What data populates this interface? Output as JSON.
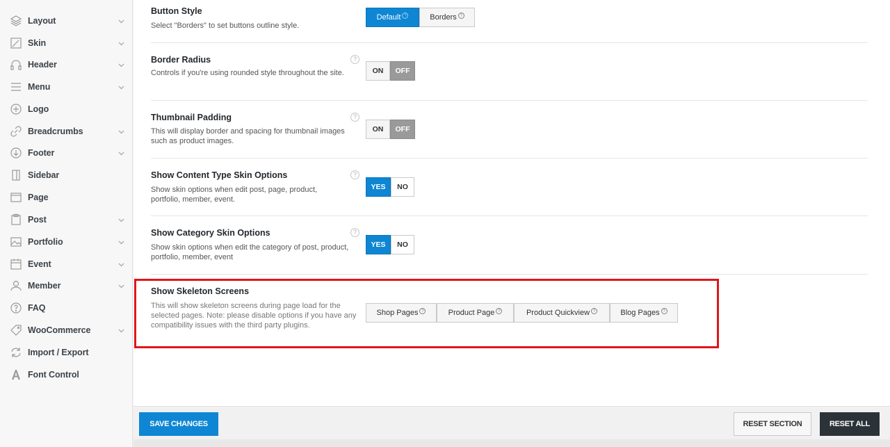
{
  "sidebar": {
    "items": [
      {
        "label": "Layout",
        "icon": "layers-icon",
        "chevron": true
      },
      {
        "label": "Skin",
        "icon": "brush-icon",
        "chevron": true
      },
      {
        "label": "Header",
        "icon": "headphones-icon",
        "chevron": true
      },
      {
        "label": "Menu",
        "icon": "menu-icon",
        "chevron": true
      },
      {
        "label": "Logo",
        "icon": "plus-circle-icon",
        "chevron": false
      },
      {
        "label": "Breadcrumbs",
        "icon": "link-icon",
        "chevron": true
      },
      {
        "label": "Footer",
        "icon": "arrow-down-circle-icon",
        "chevron": true
      },
      {
        "label": "Sidebar",
        "icon": "sidebar-icon",
        "chevron": false
      },
      {
        "label": "Page",
        "icon": "browser-icon",
        "chevron": false
      },
      {
        "label": "Post",
        "icon": "clipboard-icon",
        "chevron": true
      },
      {
        "label": "Portfolio",
        "icon": "image-icon",
        "chevron": true
      },
      {
        "label": "Event",
        "icon": "calendar-icon",
        "chevron": true
      },
      {
        "label": "Member",
        "icon": "user-icon",
        "chevron": true
      },
      {
        "label": "FAQ",
        "icon": "question-circle-icon",
        "chevron": false
      },
      {
        "label": "WooCommerce",
        "icon": "tag-icon",
        "chevron": true
      },
      {
        "label": "Import / Export",
        "icon": "refresh-icon",
        "chevron": false
      },
      {
        "label": "Font Control",
        "icon": "font-icon",
        "chevron": false
      }
    ]
  },
  "settings": {
    "button_style": {
      "title": "Button Style",
      "desc": "Select \"Borders\" to set buttons outline style.",
      "options": [
        "Default",
        "Borders"
      ],
      "selected": "Default"
    },
    "border_radius": {
      "title": "Border Radius",
      "desc": "Controls if you're using rounded style throughout the site.",
      "on": "ON",
      "off": "OFF",
      "selected": "OFF"
    },
    "thumbnail_padding": {
      "title": "Thumbnail Padding",
      "desc": "This will display border and spacing for thumbnail images such as product images.",
      "on": "ON",
      "off": "OFF",
      "selected": "OFF"
    },
    "content_type_skin": {
      "title": "Show Content Type Skin Options",
      "desc": "Show skin options when edit post, page, product, portfolio, member, event.",
      "yes": "YES",
      "no": "NO",
      "selected": "YES"
    },
    "category_skin": {
      "title": "Show Category Skin Options",
      "desc": "Show skin options when edit the category of post, product, portfolio, member, event",
      "yes": "YES",
      "no": "NO",
      "selected": "YES"
    },
    "skeleton_screens": {
      "title": "Show Skeleton Screens",
      "desc": "This will show skeleton screens during page load for the selected pages. Note: please disable options if you have any compatibility issues with the third party plugins.",
      "options": [
        "Shop Pages",
        "Product Page",
        "Product Quickview",
        "Blog Pages"
      ]
    }
  },
  "footer": {
    "save": "SAVE CHANGES",
    "reset_section": "RESET SECTION",
    "reset_all": "RESET ALL"
  },
  "colors": {
    "accent": "#0e86d4",
    "highlight": "#e0161b",
    "dark": "#2c3338"
  }
}
